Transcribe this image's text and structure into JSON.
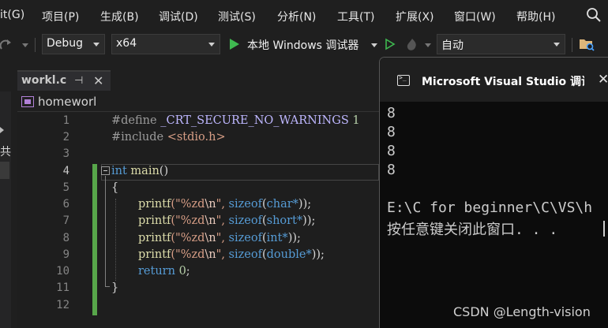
{
  "menu": {
    "items": [
      "it(G)",
      "项目(P)",
      "生成(B)",
      "调试(D)",
      "测试(S)",
      "分析(N)",
      "工具(T)",
      "扩展(X)",
      "窗口(W)",
      "帮助(H)"
    ],
    "search_icon": "search-icon"
  },
  "toolbar": {
    "config": "Debug",
    "platform": "x64",
    "run_label": "本地 Windows 调试器",
    "mode": "自动"
  },
  "editor": {
    "tab_label": "workl.c",
    "nav_label": "homeworl",
    "side_text": "共",
    "line_numbers": [
      "1",
      "2",
      "3",
      "4",
      "5",
      "6",
      "7",
      "8",
      "9",
      "10",
      "11",
      "12"
    ],
    "current_line": "4",
    "lines": {
      "l1_directive": "#define",
      "l1_macro": "_CRT_SECURE_NO_WARNINGS",
      "l1_value": "1",
      "l2_directive": "#include",
      "l2_header": "<stdio.h>",
      "l4_type": "int",
      "l4_name": "main",
      "l4_parens": "()",
      "l5": "{",
      "printf": "printf",
      "fmt_open": "(\"%zd",
      "fmt_esc": "\\n",
      "fmt_close": "\", ",
      "sizeof": "sizeof",
      "l6_type": "char*",
      "l7_type": "short*",
      "l8_type": "int*",
      "l9_type": "double*",
      "args_end": "));",
      "l10_kw": "return",
      "l10_val": "0",
      "l10_end": ";",
      "l11": "}"
    }
  },
  "console": {
    "title": "Microsoft Visual Studio 调试控制台",
    "output_lines": [
      "8",
      "8",
      "8",
      "8"
    ],
    "path_line": "E:\\C for beginner\\C\\VS\\h",
    "prompt_line": "按任意键关闭此窗口. . ."
  },
  "watermark": "CSDN @Length-vision"
}
